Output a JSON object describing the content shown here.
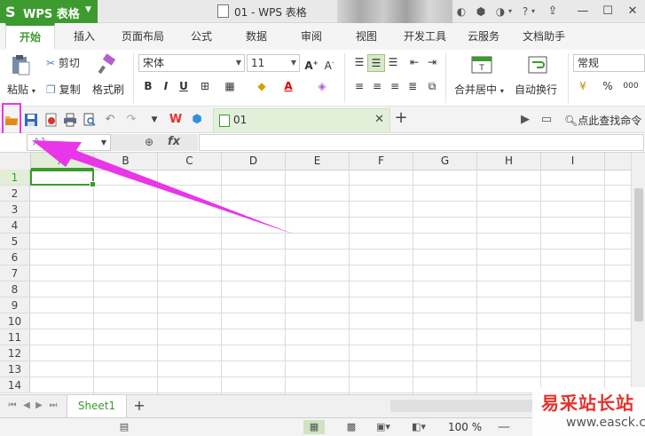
{
  "app": {
    "button_label": "WPS 表格",
    "logo_glyph": "S",
    "accent": "#3c9a2f"
  },
  "window": {
    "document_title": "01 - WPS 表格"
  },
  "ribbon_tabs": [
    "开始",
    "插入",
    "页面布局",
    "公式",
    "数据",
    "审阅",
    "视图",
    "开发工具",
    "云服务",
    "文档助手"
  ],
  "ribbon": {
    "paste": "粘贴",
    "cut": "剪切",
    "copy": "复制",
    "format_painter": "格式刷",
    "font_name": "宋体",
    "font_size": "11",
    "bold": "B",
    "italic": "I",
    "underline": "U",
    "merge_center": "合并居中",
    "wrap_text": "自动换行",
    "number_format": "常规",
    "percent": "%",
    "comma": "000"
  },
  "quick_access": {
    "doc_tab_label": "01",
    "search_command": "点此查找命令"
  },
  "formula_bar": {
    "name_box": "A1",
    "fx": "fx"
  },
  "grid": {
    "columns": [
      "A",
      "B",
      "C",
      "D",
      "E",
      "F",
      "G",
      "H",
      "I"
    ],
    "rows": [
      "1",
      "2",
      "3",
      "4",
      "5",
      "6",
      "7",
      "8",
      "9",
      "10",
      "11",
      "12",
      "13",
      "14"
    ],
    "active_cell": "A1"
  },
  "sheets": {
    "tabs": [
      "Sheet1"
    ],
    "add": "+"
  },
  "status": {
    "zoom": "100 %"
  },
  "watermark": {
    "title": "易采站长站",
    "url": "www.easck.com"
  },
  "annotation": {
    "highlight_color": "#e836e8"
  }
}
